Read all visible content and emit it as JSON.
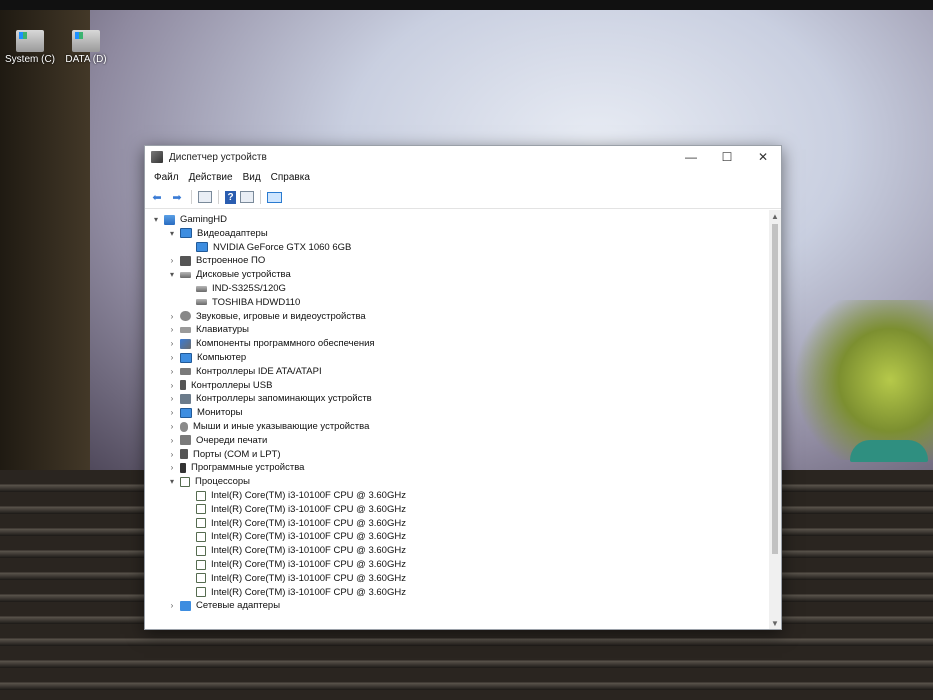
{
  "desktop": {
    "icons": [
      {
        "label": "System (C)"
      },
      {
        "label": "DATA (D)"
      }
    ]
  },
  "window": {
    "title": "Диспетчер устройств",
    "controls": {
      "minimize": "—",
      "maximize": "☐",
      "close": "✕"
    },
    "menu": [
      "Файл",
      "Действие",
      "Вид",
      "Справка"
    ],
    "scroll_up": "▲",
    "scroll_down": "▼"
  },
  "tree": [
    {
      "label": "GamingHD",
      "level": 0,
      "expander": "▾",
      "icon": "computer"
    },
    {
      "label": "Видеоадаптеры",
      "level": 1,
      "expander": "▾",
      "icon": "monitor"
    },
    {
      "label": "NVIDIA GeForce GTX 1060 6GB",
      "level": 2,
      "expander": "",
      "icon": "monitor"
    },
    {
      "label": "Встроенное ПО",
      "level": 1,
      "expander": "›",
      "icon": "chip"
    },
    {
      "label": "Дисковые устройства",
      "level": 1,
      "expander": "▾",
      "icon": "disk"
    },
    {
      "label": "IND-S325S/120G",
      "level": 2,
      "expander": "",
      "icon": "disk"
    },
    {
      "label": "TOSHIBA HDWD110",
      "level": 2,
      "expander": "",
      "icon": "disk"
    },
    {
      "label": "Звуковые, игровые и видеоустройства",
      "level": 1,
      "expander": "›",
      "icon": "sound"
    },
    {
      "label": "Клавиатуры",
      "level": 1,
      "expander": "›",
      "icon": "keyboard"
    },
    {
      "label": "Компоненты программного обеспечения",
      "level": 1,
      "expander": "›",
      "icon": "component"
    },
    {
      "label": "Компьютер",
      "level": 1,
      "expander": "›",
      "icon": "monitor"
    },
    {
      "label": "Контроллеры IDE ATA/ATAPI",
      "level": 1,
      "expander": "›",
      "icon": "ide"
    },
    {
      "label": "Контроллеры USB",
      "level": 1,
      "expander": "›",
      "icon": "usb"
    },
    {
      "label": "Контроллеры запоминающих устройств",
      "level": 1,
      "expander": "›",
      "icon": "storage"
    },
    {
      "label": "Мониторы",
      "level": 1,
      "expander": "›",
      "icon": "monitor"
    },
    {
      "label": "Мыши и иные указывающие устройства",
      "level": 1,
      "expander": "›",
      "icon": "mouse"
    },
    {
      "label": "Очереди печати",
      "level": 1,
      "expander": "›",
      "icon": "printer"
    },
    {
      "label": "Порты (COM и LPT)",
      "level": 1,
      "expander": "›",
      "icon": "port"
    },
    {
      "label": "Программные устройства",
      "level": 1,
      "expander": "›",
      "icon": "software"
    },
    {
      "label": "Процессоры",
      "level": 1,
      "expander": "▾",
      "icon": "cpu"
    },
    {
      "label": "Intel(R) Core(TM) i3-10100F CPU @ 3.60GHz",
      "level": 2,
      "expander": "",
      "icon": "cpu"
    },
    {
      "label": "Intel(R) Core(TM) i3-10100F CPU @ 3.60GHz",
      "level": 2,
      "expander": "",
      "icon": "cpu"
    },
    {
      "label": "Intel(R) Core(TM) i3-10100F CPU @ 3.60GHz",
      "level": 2,
      "expander": "",
      "icon": "cpu"
    },
    {
      "label": "Intel(R) Core(TM) i3-10100F CPU @ 3.60GHz",
      "level": 2,
      "expander": "",
      "icon": "cpu"
    },
    {
      "label": "Intel(R) Core(TM) i3-10100F CPU @ 3.60GHz",
      "level": 2,
      "expander": "",
      "icon": "cpu"
    },
    {
      "label": "Intel(R) Core(TM) i3-10100F CPU @ 3.60GHz",
      "level": 2,
      "expander": "",
      "icon": "cpu"
    },
    {
      "label": "Intel(R) Core(TM) i3-10100F CPU @ 3.60GHz",
      "level": 2,
      "expander": "",
      "icon": "cpu"
    },
    {
      "label": "Intel(R) Core(TM) i3-10100F CPU @ 3.60GHz",
      "level": 2,
      "expander": "",
      "icon": "cpu"
    },
    {
      "label": "Сетевые адаптеры",
      "level": 1,
      "expander": "›",
      "icon": "network"
    }
  ]
}
